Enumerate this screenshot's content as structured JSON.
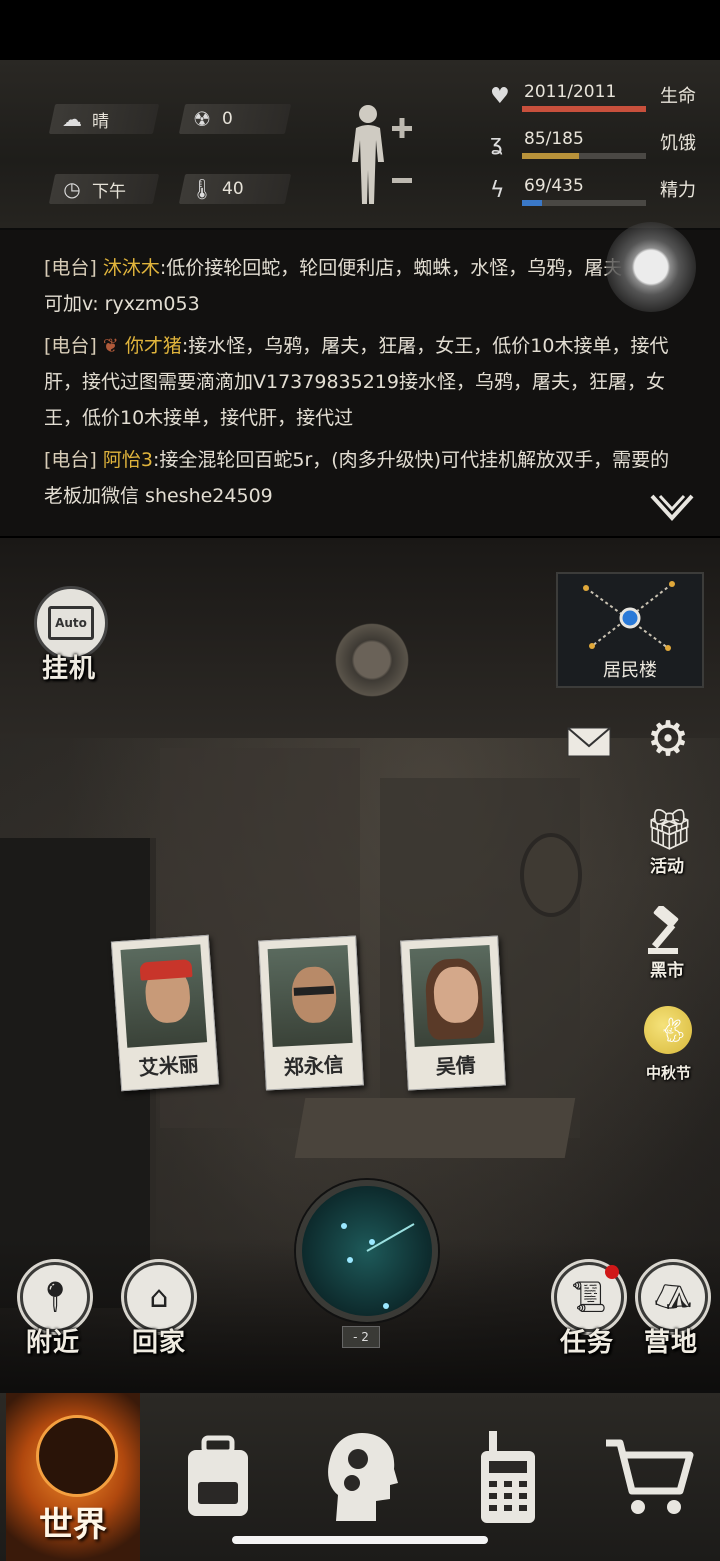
{
  "status": {
    "weather": {
      "icon": "cloud-sun-icon",
      "label": "晴"
    },
    "radiation": {
      "icon": "radiation-icon",
      "value": "0"
    },
    "time": {
      "icon": "clock-icon",
      "label": "下午"
    },
    "temperature": {
      "icon": "thermometer-icon",
      "value": "40"
    },
    "body_icon": "body-figure-icon",
    "stats": [
      {
        "icon": "heart-icon",
        "value": "2011/2011",
        "name": "生命",
        "fraction": 1.0,
        "color": "#c8503c"
      },
      {
        "icon": "stomach-icon",
        "value": "85/185",
        "name": "饥饿",
        "fraction": 0.46,
        "color": "#b8923a"
      },
      {
        "icon": "energy-icon",
        "value": "69/435",
        "name": "精力",
        "fraction": 0.16,
        "color": "#3a78c8"
      }
    ]
  },
  "radio": {
    "messages": [
      {
        "tag": "[电台]",
        "nick": "沐沐木",
        "text": ":低价接轮回蛇，轮回便利店，蜘蛛，水怪，乌鸦，屠夫，有意可加v: ryxzm053"
      },
      {
        "tag": "[电台]",
        "nick": "你才猪",
        "text": ":接水怪，乌鸦，屠夫，狂屠，女王，低价10木接单，接代肝，接代过图需要滴滴加V17379835219接水怪，乌鸦，屠夫，狂屠，女王，低价10木接单，接代肝，接代过"
      },
      {
        "tag": "[电台]",
        "nick": "阿怡3",
        "text": ":接全混轮回百蛇5r，(肉多升级快)可代挂机解放双手，需要的老板加微信 sheshe24509"
      }
    ]
  },
  "scene": {
    "auto_label": "Auto",
    "idle_label": "挂机",
    "map_location": "居民楼",
    "activity_label": "活动",
    "black_market_label": "黑市",
    "festival_label": "中秋节",
    "radar_level": "- 2",
    "survivors": [
      "艾米丽",
      "郑永信",
      "吴倩"
    ],
    "nearby_label": "附近",
    "home_label": "回家",
    "tasks_label": "任务",
    "camp_label": "营地"
  },
  "nav": {
    "world_label": "世界"
  }
}
